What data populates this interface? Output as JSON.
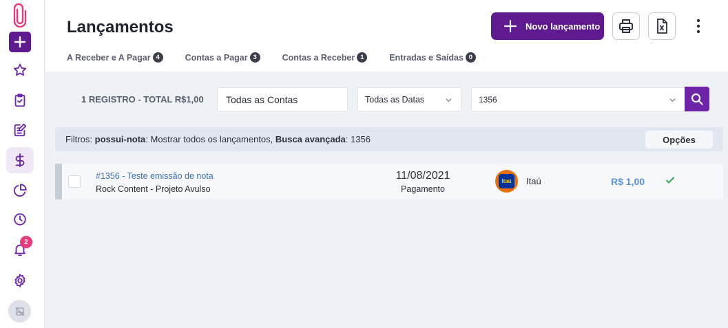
{
  "sidebar": {
    "notifications_count": "2",
    "items": [
      "logo-icon",
      "add-icon",
      "star-icon",
      "clipboard-check-icon",
      "edit-icon",
      "dollar-icon",
      "pie-chart-icon",
      "clock-icon",
      "bell-icon",
      "gear-icon",
      "avatar-placeholder-icon"
    ]
  },
  "header": {
    "title": "Lançamentos",
    "new_button_label": "Novo lançamento",
    "accent_color": "#5f1a8f"
  },
  "tabs": [
    {
      "label": "A Receber e A Pagar",
      "count": "4"
    },
    {
      "label": "Contas a Pagar",
      "count": "3"
    },
    {
      "label": "Contas a Receber",
      "count": "1"
    },
    {
      "label": "Entradas e Saídas",
      "count": "0"
    }
  ],
  "filters": {
    "total_label": "1 REGISTRO - TOTAL R$1,00",
    "account_select": "Todas as Contas",
    "date_select": "Todas as Datas",
    "search_value": "1356"
  },
  "summary": {
    "prefix": "Filtros: ",
    "key1": "possui-nota",
    "value1": ": Mostrar todos os lançamentos, ",
    "key2": "Busca avançada",
    "value2": ": 1356",
    "options_label": "Opções"
  },
  "rows": [
    {
      "title": "#1356 - Teste emissão de nota",
      "subtitle": "Rock Content - Projeto Avulso",
      "date": "11/08/2021",
      "type": "Pagamento",
      "bank_logo_text": "Itaú",
      "bank": "Itaú",
      "amount": "R$ 1,00",
      "status": "check-icon"
    }
  ]
}
